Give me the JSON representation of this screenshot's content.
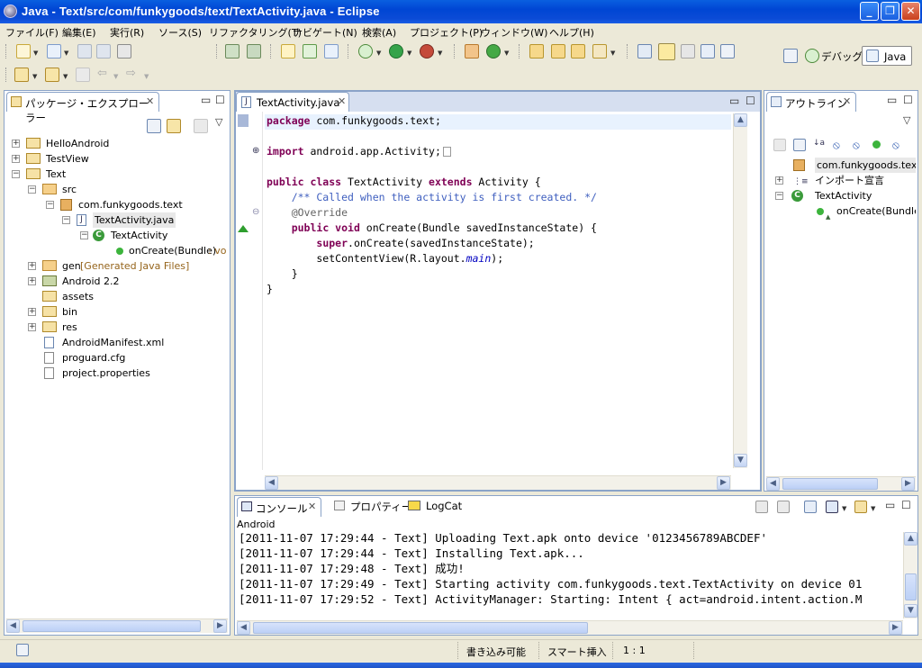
{
  "window": {
    "title": "Java - Text/src/com/funkygoods/text/TextActivity.java - Eclipse"
  },
  "menu": [
    "ファイル(F)",
    "編集(E)",
    "実行(R)",
    "ソース(S)",
    "リファクタリング(T)",
    "ナビゲート(N)",
    "検索(A)",
    "プロジェクト(P)",
    "ウィンドウ(W)",
    "ヘルプ(H)"
  ],
  "perspectives": {
    "debug": "デバッグ",
    "java": "Java"
  },
  "package_explorer": {
    "title": "パッケージ・エクスプローラー",
    "items": [
      {
        "label": "HelloAndroid"
      },
      {
        "label": "TestView"
      },
      {
        "label": "Text"
      },
      {
        "label": "src"
      },
      {
        "label": "com.funkygoods.text"
      },
      {
        "label": "TextActivity.java"
      },
      {
        "label": "TextActivity"
      },
      {
        "label": "onCreate(Bundle)",
        "suffix": " : vo"
      },
      {
        "label": "gen",
        "suffix": " [Generated Java Files]"
      },
      {
        "label": "Android 2.2"
      },
      {
        "label": "assets"
      },
      {
        "label": "bin"
      },
      {
        "label": "res"
      },
      {
        "label": "AndroidManifest.xml"
      },
      {
        "label": "proguard.cfg"
      },
      {
        "label": "project.properties"
      }
    ]
  },
  "editor": {
    "tab": "TextActivity.java",
    "lines": [
      "package com.funkygoods.text;",
      "",
      "import android.app.Activity;",
      "",
      "public class TextActivity extends Activity {",
      "    /** Called when the activity is first created. */",
      "    @Override",
      "    public void onCreate(Bundle savedInstanceState) {",
      "        super.onCreate(savedInstanceState);",
      "        setContentView(R.layout.main);",
      "    }",
      "}"
    ]
  },
  "outline": {
    "title": "アウトライン",
    "items": [
      "com.funkygoods.text",
      "インポート宣言",
      "TextActivity",
      "onCreate(Bundle)"
    ]
  },
  "console": {
    "tabs": {
      "console": "コンソール",
      "properties": "プロパティー",
      "logcat": "LogCat"
    },
    "name": "Android",
    "lines": [
      "[2011-11-07 17:29:44 - Text] Uploading Text.apk onto device '0123456789ABCDEF'",
      "[2011-11-07 17:29:44 - Text] Installing Text.apk...",
      "[2011-11-07 17:29:48 - Text] 成功!",
      "[2011-11-07 17:29:49 - Text] Starting activity com.funkygoods.text.TextActivity on device 01",
      "[2011-11-07 17:29:52 - Text] ActivityManager: Starting: Intent { act=android.intent.action.M"
    ]
  },
  "status": {
    "writable": "書き込み可能",
    "insert_mode": "スマート挿入",
    "position": "1 : 1"
  },
  "colors": {
    "keyword": "#7f0055",
    "comment": "#3f5fbf",
    "titlebar": "#0046d4"
  }
}
